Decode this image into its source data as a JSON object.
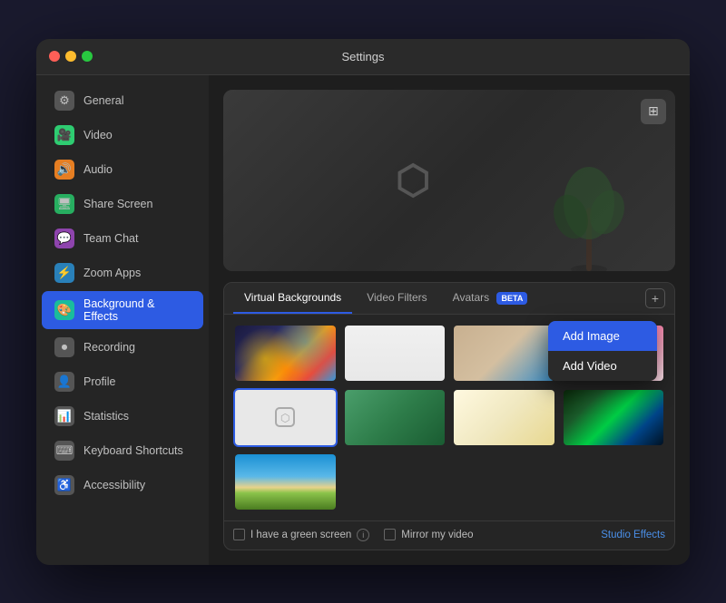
{
  "window": {
    "title": "Settings"
  },
  "sidebar": {
    "items": [
      {
        "id": "general",
        "label": "General",
        "iconClass": "icon-general",
        "icon": "⚙"
      },
      {
        "id": "video",
        "label": "Video",
        "iconClass": "icon-video",
        "icon": "📹"
      },
      {
        "id": "audio",
        "label": "Audio",
        "iconClass": "icon-audio",
        "icon": "🔊"
      },
      {
        "id": "share-screen",
        "label": "Share Screen",
        "iconClass": "icon-share",
        "icon": "🖥"
      },
      {
        "id": "team-chat",
        "label": "Team Chat",
        "iconClass": "icon-team",
        "icon": "💬"
      },
      {
        "id": "zoom-apps",
        "label": "Zoom Apps",
        "iconClass": "icon-zoom",
        "icon": "⚡"
      },
      {
        "id": "background",
        "label": "Background & Effects",
        "iconClass": "icon-bg",
        "icon": "🎨",
        "active": true
      },
      {
        "id": "recording",
        "label": "Recording",
        "iconClass": "icon-recording",
        "icon": "⏺"
      },
      {
        "id": "profile",
        "label": "Profile",
        "iconClass": "icon-profile",
        "icon": "👤"
      },
      {
        "id": "statistics",
        "label": "Statistics",
        "iconClass": "icon-stats",
        "icon": "📊"
      },
      {
        "id": "keyboard",
        "label": "Keyboard Shortcuts",
        "iconClass": "icon-keyboard",
        "icon": "⌨"
      },
      {
        "id": "accessibility",
        "label": "Accessibility",
        "iconClass": "icon-access",
        "icon": "♿"
      }
    ]
  },
  "tabs": [
    {
      "id": "virtual-bg",
      "label": "Virtual Backgrounds",
      "active": true
    },
    {
      "id": "video-filters",
      "label": "Video Filters",
      "active": false
    },
    {
      "id": "avatars",
      "label": "Avatars",
      "active": false,
      "badge": "BETA"
    }
  ],
  "dropdown": {
    "items": [
      {
        "id": "add-image",
        "label": "Add Image",
        "highlighted": true
      },
      {
        "id": "add-video",
        "label": "Add Video",
        "highlighted": false
      }
    ]
  },
  "footer": {
    "greenscreen_label": "I have a green screen",
    "mirror_label": "Mirror my video",
    "studio_label": "Studio Effects"
  },
  "add_button_label": "+",
  "preview_button_icon": "⊞"
}
